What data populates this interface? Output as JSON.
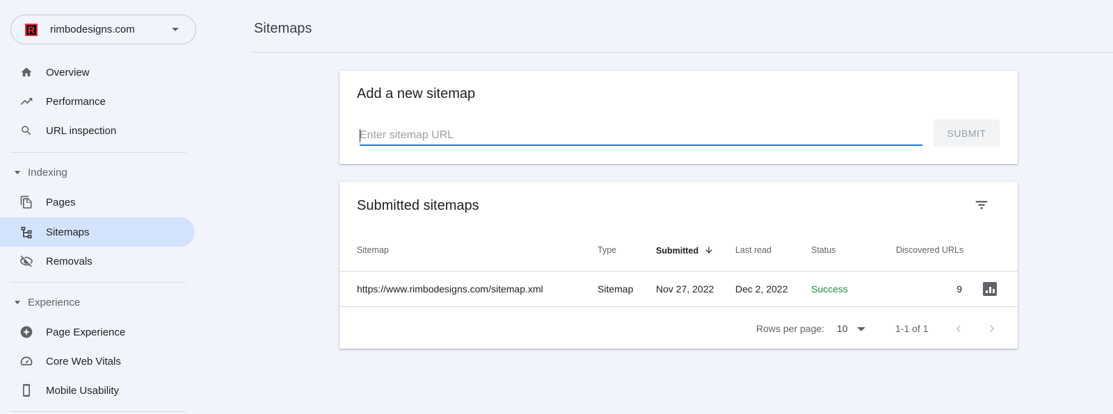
{
  "property": {
    "name": "rimbodesigns.com",
    "logo_letter": "R"
  },
  "nav": {
    "overview": "Overview",
    "performance": "Performance",
    "url_inspection": "URL inspection",
    "indexing_section": "Indexing",
    "pages": "Pages",
    "sitemaps": "Sitemaps",
    "removals": "Removals",
    "experience_section": "Experience",
    "page_experience": "Page Experience",
    "core_web_vitals": "Core Web Vitals",
    "mobile_usability": "Mobile Usability"
  },
  "page": {
    "title": "Sitemaps"
  },
  "add_sitemap": {
    "title": "Add a new sitemap",
    "placeholder": "Enter sitemap URL",
    "submit_label": "SUBMIT"
  },
  "submitted": {
    "title": "Submitted sitemaps",
    "columns": {
      "sitemap": "Sitemap",
      "type": "Type",
      "submitted": "Submitted",
      "last_read": "Last read",
      "status": "Status",
      "discovered_urls": "Discovered URLs"
    },
    "rows": [
      {
        "sitemap": "https://www.rimbodesigns.com/sitemap.xml",
        "type": "Sitemap",
        "submitted": "Nov 27, 2022",
        "last_read": "Dec 2, 2022",
        "status": "Success",
        "discovered_urls": "9"
      }
    ],
    "footer": {
      "rows_per_page_label": "Rows per page:",
      "rows_per_page_value": "10",
      "range": "1-1 of 1"
    }
  },
  "colors": {
    "background": "#f1f4fb",
    "active_nav": "#d3e3fd",
    "accent": "#1a73e8",
    "success": "#1e8e3e"
  }
}
